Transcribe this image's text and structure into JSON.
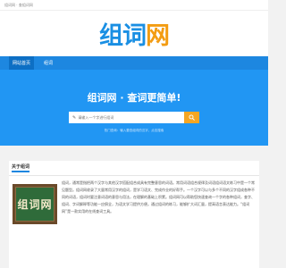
{
  "topbar": {
    "text": "组词网 · 查组词网"
  },
  "logo": {
    "part1": "组词",
    "part2": "网"
  },
  "nav": {
    "items": [
      {
        "label": "网站首页"
      },
      {
        "label": "组词"
      }
    ]
  },
  "hero": {
    "title": "组词网 · 查词更简单!",
    "search_placeholder": "请输入一个字进行组词",
    "hint": "热门查询：输入要查组词的汉字，点击搜索"
  },
  "about": {
    "heading": "关于组词",
    "board_text": "组词网",
    "body": "组词，通常是指把两个汉字与其他汉字搭配组合成具有完整意思的词语。常用词语组合规律及词语组词语文练习中是一个常见题型。组词网收录了大量常用汉字的组词，是学习语文、完成作业的好帮手。一个汉字可以与多个不同的汉字组成各种不同的词语，组词时要注意词语的意思与用法，在理解的基础上积累。组词网可以帮助您快速查询一个字的各种组词，查字、组词、字词解释等功能一应俱全，为语文学习提供方便。通过组词的练习，能够扩大词汇量，提高语言表达能力。“组词网”是一款实用的在线查词工具。"
  },
  "colors": {
    "primary": "#1d87e0",
    "hero": "#2196f3",
    "accent": "#f5a623"
  },
  "icons": {
    "search": "search-icon",
    "pencil": "pencil-icon"
  }
}
